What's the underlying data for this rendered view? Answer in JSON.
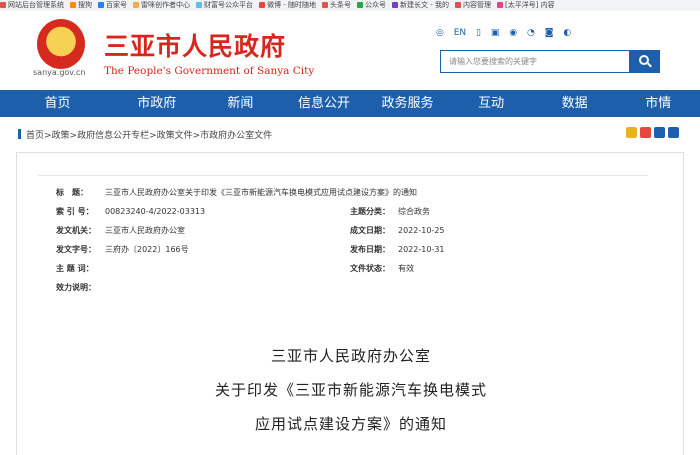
{
  "bookmarks": [
    {
      "label": "网站后台管理系统",
      "color": "#d9534f"
    },
    {
      "label": "搜狗",
      "color": "#ff8c00"
    },
    {
      "label": "百家号",
      "color": "#2b7de9"
    },
    {
      "label": "雷咪创作者中心",
      "color": "#f0ad4e"
    },
    {
      "label": "财富号公众平台",
      "color": "#5bc0de"
    },
    {
      "label": "微博 - 随时随地",
      "color": "#e8453c"
    },
    {
      "label": "头条号",
      "color": "#d9534f"
    },
    {
      "label": "公众号",
      "color": "#28a745"
    },
    {
      "label": "新建长文 - 我的",
      "color": "#6f42c1"
    },
    {
      "label": "内容管理",
      "color": "#d9534f"
    },
    {
      "label": "[太平洋号] 内容",
      "color": "#e83e8c"
    }
  ],
  "header": {
    "domain": "sanya.gov.cn",
    "title_cn": "三亚市人民政府",
    "title_en": "The People's Government of Sanya City",
    "lang": "EN",
    "search_placeholder": "请输入您要搜索的关键字"
  },
  "nav": [
    "首页",
    "市政府",
    "新闻",
    "信息公开",
    "政务服务",
    "互动",
    "数据",
    "市情"
  ],
  "breadcrumb": "首页>政策>政府信息公开专栏>政策文件>市政府办公室文件",
  "meta": {
    "title_label": "标　题：",
    "title_value": "三亚市人民政府办公室关于印发《三亚市新能源汽车换电模式应用试点建设方案》的通知",
    "index_label": "索 引 号：",
    "index_value": "00823240-4/2022-03313",
    "category_label": "主题分类：",
    "category_value": "综合政务",
    "issuer_label": "发文机关：",
    "issuer_value": "三亚市人民政府办公室",
    "created_label": "成文日期：",
    "created_value": "2022-10-25",
    "docno_label": "发文字号：",
    "docno_value": "三府办〔2022〕166号",
    "published_label": "发布日期：",
    "published_value": "2022-10-31",
    "subject_label": "主 题 词：",
    "subject_value": "",
    "status_label": "文件状态：",
    "status_value": "有效",
    "validity_label": "效力说明：",
    "validity_value": ""
  },
  "doc_title": {
    "line1": "三亚市人民政府办公室",
    "line2": "关于印发《三亚市新能源汽车换电模式",
    "line3": "应用试点建设方案》的通知"
  }
}
